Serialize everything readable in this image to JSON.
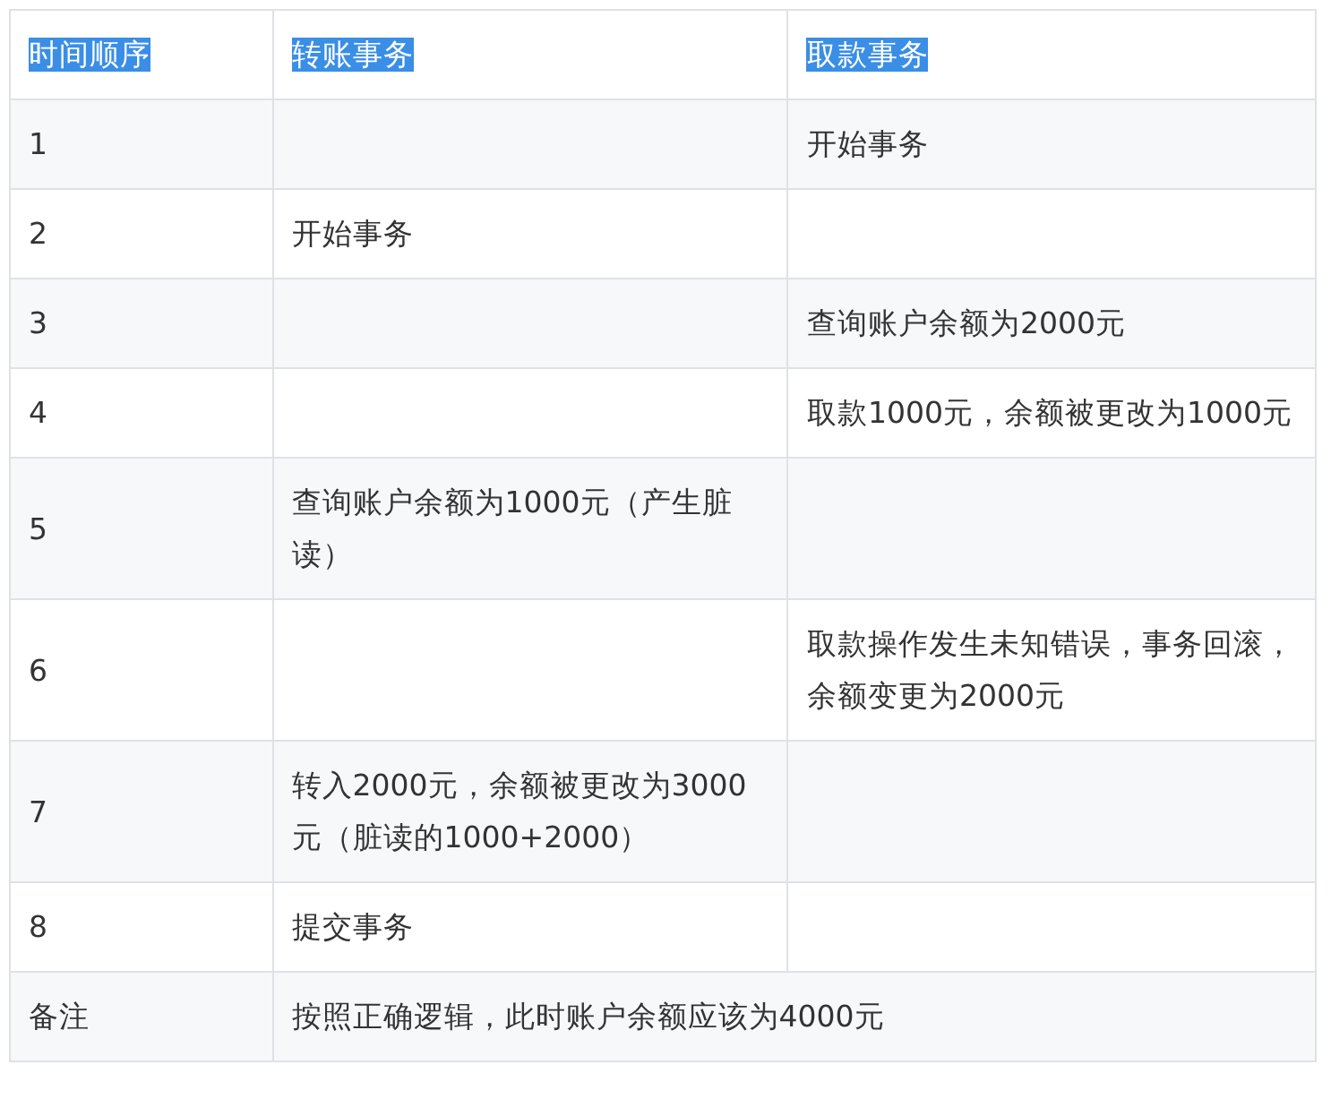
{
  "table": {
    "columns": [
      {
        "label": "时间顺序",
        "highlighted": true
      },
      {
        "label": "转账事务",
        "highlighted": true
      },
      {
        "label": "取款事务",
        "highlighted": true
      }
    ],
    "rows": [
      {
        "kind": "step",
        "time": "1",
        "withdraw": "开始事务"
      },
      {
        "kind": "step",
        "time": "2",
        "transfer": "开始事务"
      },
      {
        "kind": "step",
        "time": "3",
        "withdraw": "查询账户余额为2000元"
      },
      {
        "kind": "step",
        "time": "4",
        "withdraw": "取款1000元，余额被更改为1000元"
      },
      {
        "kind": "step",
        "time": "5",
        "transfer": "查询账户余额为1000元（产生脏读）"
      },
      {
        "kind": "step",
        "time": "6",
        "withdraw": "取款操作发生未知错误，事务回滚，余额变更为2000元"
      },
      {
        "kind": "step",
        "time": "7",
        "transfer": "转入2000元，余额被更改为3000元（脏读的1000+2000）"
      },
      {
        "kind": "step",
        "time": "8",
        "transfer": "提交事务"
      },
      {
        "kind": "note",
        "time": "备注",
        "note": "按照正确逻辑，此时账户余额应该为4000元"
      }
    ]
  }
}
